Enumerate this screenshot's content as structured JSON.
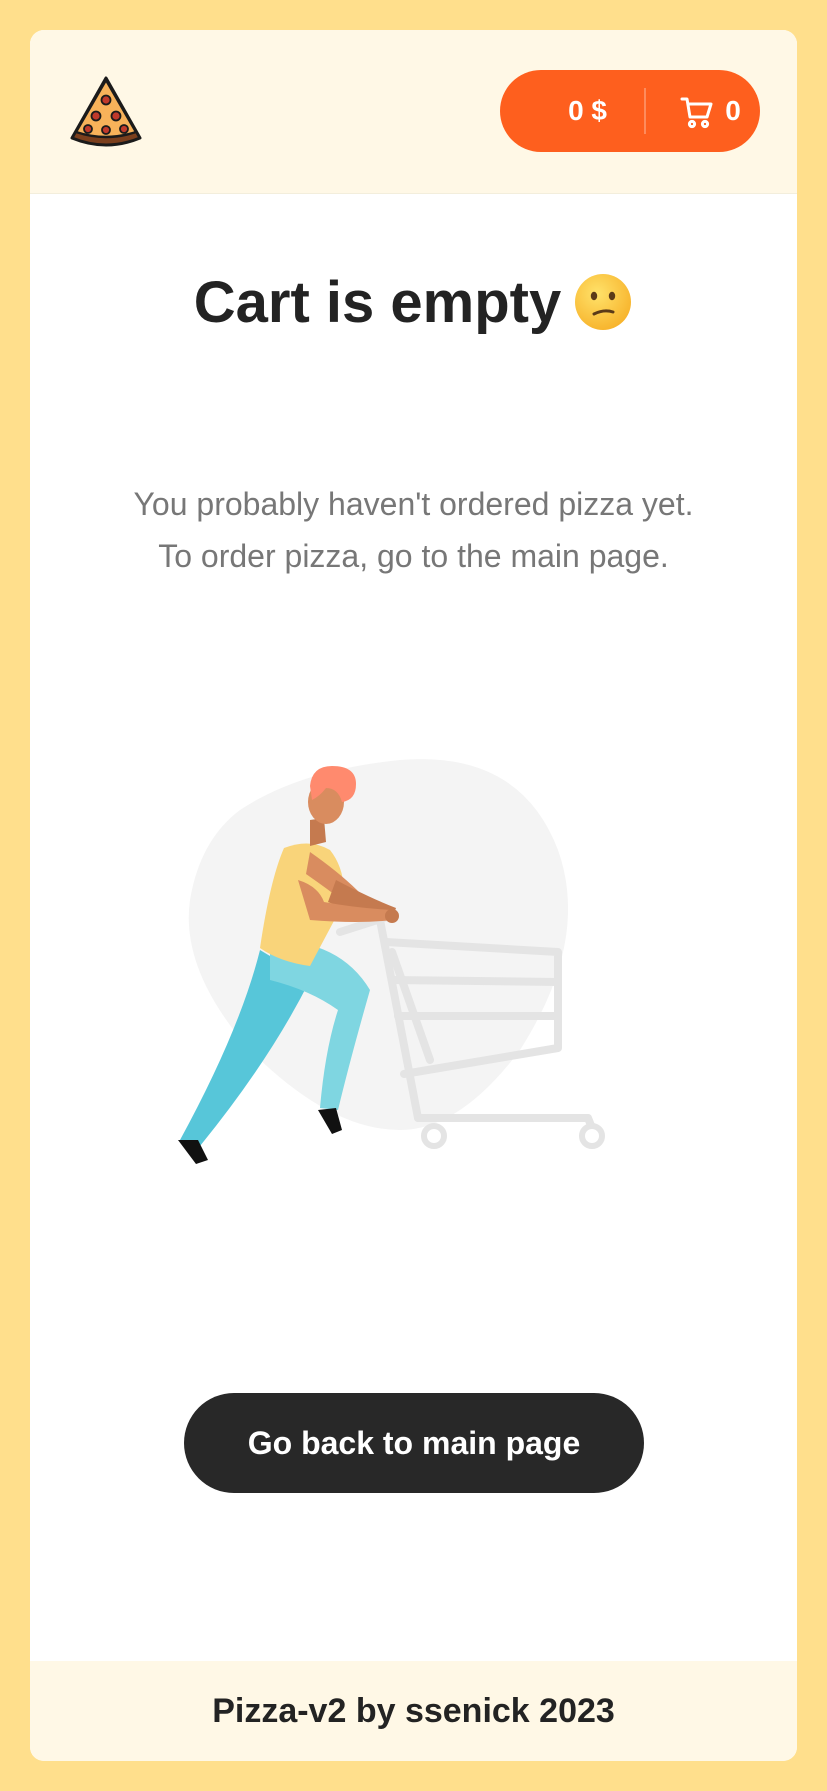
{
  "header": {
    "logo_icon": "pizza-slice-icon",
    "cart": {
      "price": "0 $",
      "count": "0",
      "icon": "shopping-cart-icon",
      "accent_color": "#fe5f1e"
    }
  },
  "main": {
    "title": "Cart is empty",
    "title_emoji": "confused-face-emoji",
    "description_line1": "You probably haven't ordered pizza yet.",
    "description_line2": "To order pizza, go to the main page.",
    "illustration": "person-pushing-empty-shopping-cart",
    "back_button_label": "Go back to main page"
  },
  "footer": {
    "text": "Pizza-v2 by ssenick 2023"
  },
  "colors": {
    "page_background": "#ffdf8c",
    "header_background": "#fff8e6",
    "button_dark": "#282828"
  }
}
